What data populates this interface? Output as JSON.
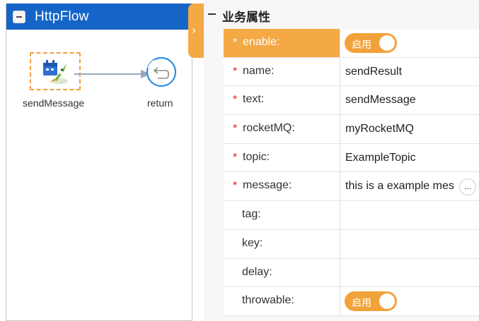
{
  "flow": {
    "title": "HttpFlow",
    "nodes": {
      "send": {
        "label": "sendMessage",
        "icon": "rocket-calendar-icon"
      },
      "return": {
        "label": "return",
        "icon": "return-icon"
      }
    }
  },
  "section": {
    "title": "业务属性"
  },
  "properties": [
    {
      "name": "enable:",
      "required": "*",
      "type": "toggle",
      "toggle_label": "启用"
    },
    {
      "name": "name:",
      "required": "*",
      "value": "sendResult"
    },
    {
      "name": "text:",
      "required": "*",
      "value": "sendMessage"
    },
    {
      "name": "rocketMQ:",
      "required": "*",
      "value": "myRocketMQ"
    },
    {
      "name": "topic:",
      "required": "*",
      "value": "ExampleTopic"
    },
    {
      "name": "message:",
      "required": "*",
      "value": "this is a example mes",
      "action": "..."
    },
    {
      "name": "tag:",
      "value": ""
    },
    {
      "name": "key:",
      "value": ""
    },
    {
      "name": "delay:",
      "value": ""
    },
    {
      "name": "throwable:",
      "type": "toggle",
      "toggle_label": "启用"
    }
  ],
  "colors": {
    "header_blue": "#1565c8",
    "accent_orange": "#f4a945",
    "required_red": "#e02020"
  }
}
